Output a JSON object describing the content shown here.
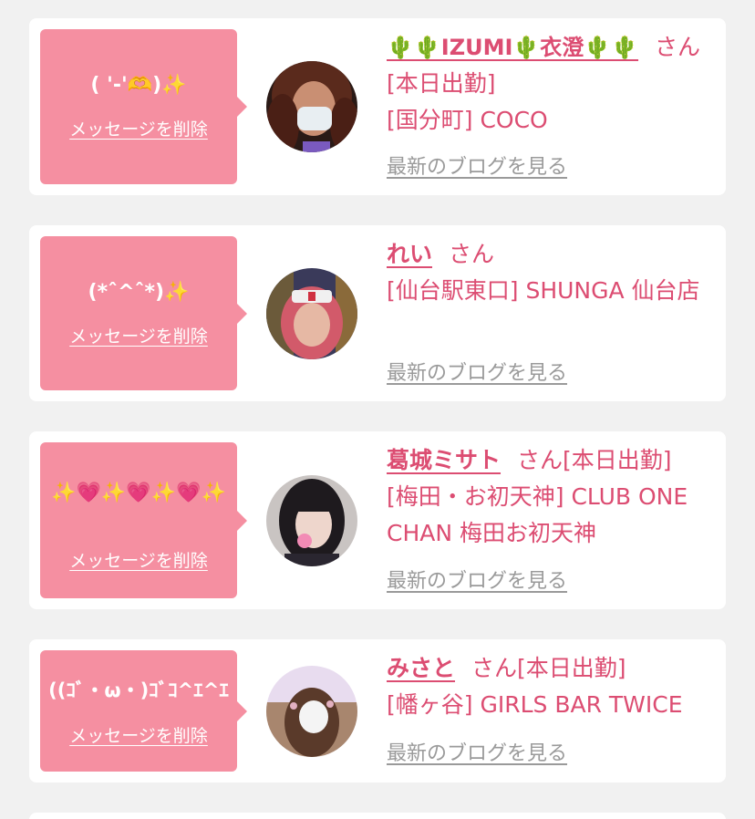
{
  "common": {
    "delete_label": "メッセージを削除",
    "blog_label": "最新のブログを見る",
    "honorific": "さん"
  },
  "cards": [
    {
      "message": "( '-'🫶)✨",
      "name": "🌵🌵IZUMI🌵衣澄🌵🌵",
      "status": "[本日出勤]",
      "shop": "[国分町] COCO"
    },
    {
      "message": "(*ˆ^ˆ*)✨",
      "name": "れい",
      "status": "",
      "shop": "[仙台駅東口] SHUNGA 仙台店"
    },
    {
      "message": "✨💗✨💗✨💗✨",
      "name": "葛城ミサト",
      "status": "[本日出勤]",
      "shop": "[梅田・お初天神] CLUB ONE CHAN 梅田お初天神"
    },
    {
      "message": "((ｺﾞ・ω・)ｺﾞｺ^ｴ^ｴ",
      "name": "みさと",
      "status": "[本日出勤]",
      "shop": "[幡ヶ谷] GIRLS BAR TWICE"
    }
  ],
  "colors": {
    "bubble": "#f58fa1",
    "accent": "#dc4d72",
    "link_gray": "#9a9a9a",
    "background": "#f1f1f1"
  }
}
